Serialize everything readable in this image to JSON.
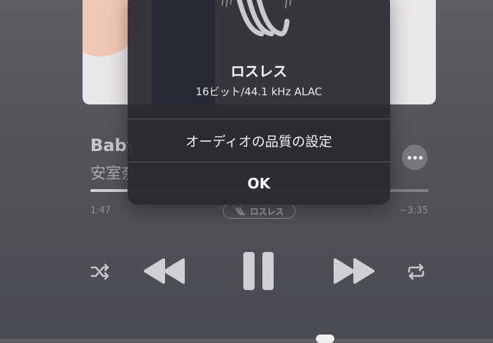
{
  "track": {
    "title": "Baby",
    "artist": "安室奈",
    "progress_fraction": 0.11
  },
  "player": {
    "elapsed": "1:47",
    "remaining": "−3:35",
    "lossless_badge": "ロスレス"
  },
  "controls": {
    "shuffle_icon": "shuffle-icon",
    "rewind_icon": "rewind-icon",
    "pause_icon": "pause-icon",
    "forward_icon": "forward-icon",
    "repeat_icon": "repeat-icon",
    "more_icon": "ellipsis-icon"
  },
  "dialog": {
    "title": "ロスレス",
    "subtitle": "16ビット/44.1 kHz ALAC",
    "option": "オーディオの品質の設定",
    "ok": "OK"
  },
  "colors": {
    "background": "#55565c",
    "dialog": "#28282e",
    "artwork_blue": "#1f3a86"
  }
}
